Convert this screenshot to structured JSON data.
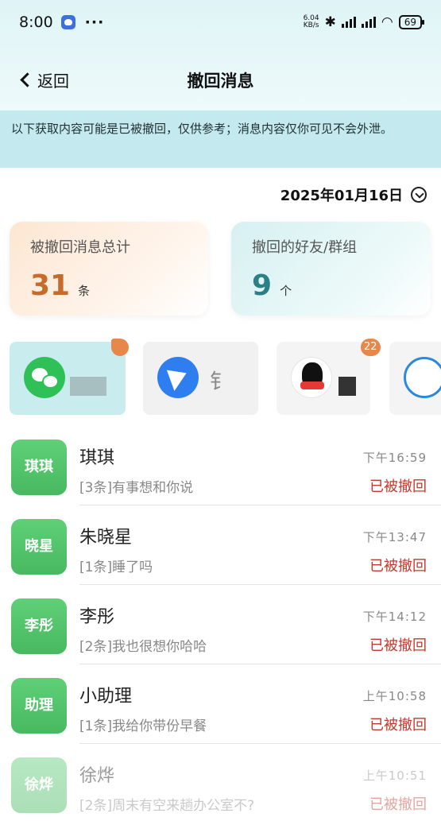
{
  "status_bar": {
    "time": "8:00",
    "dots": "···",
    "net_speed_value": "6.04",
    "net_speed_unit": "KB/s",
    "battery": "69"
  },
  "nav": {
    "back_label": "返回",
    "title": "撤回消息"
  },
  "notice": "以下获取内容可能是已被撤回，仅供参考；消息内容仅你可见不会外泄。",
  "date": "2025年01月16日",
  "stats": {
    "total_label": "被撤回消息总计",
    "total_value": "31",
    "total_unit": "条",
    "contacts_label": "撤回的好友/群组",
    "contacts_value": "9",
    "contacts_unit": "个"
  },
  "apps": [
    {
      "icon": "wechat-logo-icon",
      "name_partial": ""
    },
    {
      "icon": "dingtalk-logo-icon",
      "name_partial": "钅"
    },
    {
      "icon": "qq-logo-icon",
      "badge": "22"
    },
    {
      "icon": "chat-bubble-logo-icon"
    }
  ],
  "messages": [
    {
      "avatar": "琪琪",
      "name": "琪琪",
      "preview": "[3条]有事想和你说",
      "time": "下午16:59",
      "status": "已被撤回"
    },
    {
      "avatar": "晓星",
      "name": "朱晓星",
      "preview": "[1条]睡了吗",
      "time": "下午13:47",
      "status": "已被撤回"
    },
    {
      "avatar": "李彤",
      "name": "李彤",
      "preview": "[2条]我也很想你哈哈",
      "time": "下午14:12",
      "status": "已被撤回"
    },
    {
      "avatar": "助理",
      "name": "小助理",
      "preview": "[1条]我给你带份早餐",
      "time": "上午10:58",
      "status": "已被撤回"
    },
    {
      "avatar": "徐烨",
      "name": "徐烨",
      "preview": "[2条]周末有空来趟办公室不?",
      "time": "上午10:51",
      "status": "已被撤回"
    }
  ],
  "colors": {
    "accent_green": "#48b960",
    "revoked_red": "#c0392b",
    "notice_bg": "#c4e9ee",
    "orange_value": "#c76b2a",
    "teal_value": "#2d7f86"
  }
}
